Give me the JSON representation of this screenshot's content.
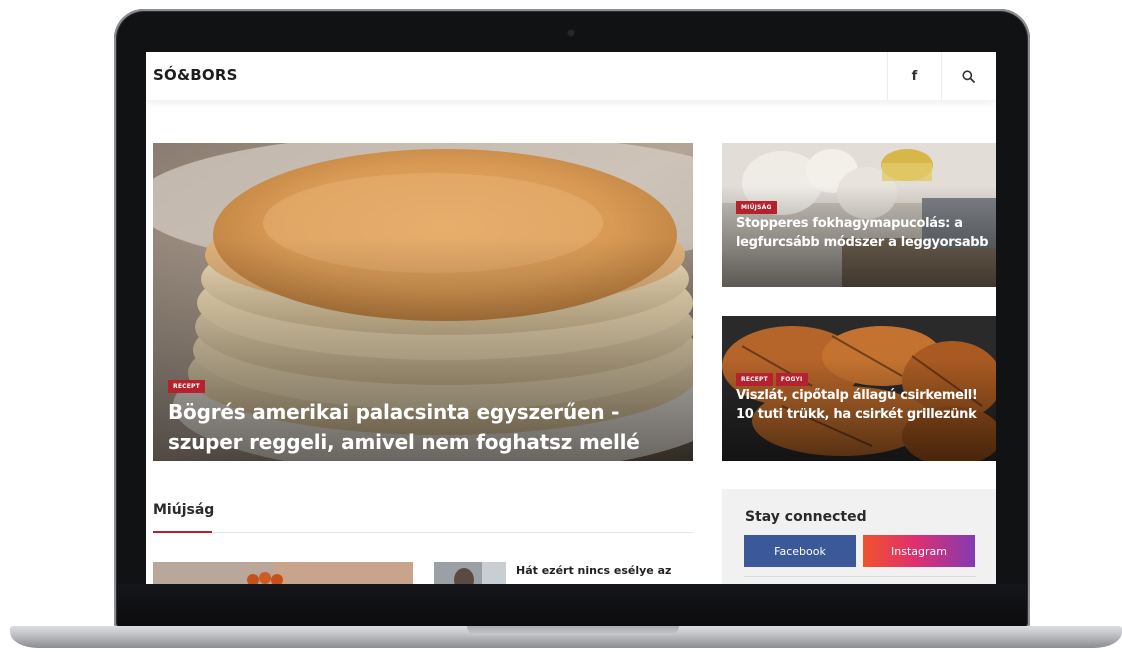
{
  "header": {
    "logo": "SÓ&BORS",
    "facebook_glyph": "f",
    "search_icon": "search-icon"
  },
  "hero": {
    "badge": "RECEPT",
    "title": "Bögrés amerikai palacsinta egyszerűen - szuper reggeli, amivel nem foghatsz mellé"
  },
  "side_cards": [
    {
      "badges": [
        "MIÚJSÁG"
      ],
      "title": "Stopperes fokhagymapucolás: a legfurcsább módszer a leggyorsabb"
    },
    {
      "badges": [
        "RECEPT",
        "FOGYI"
      ],
      "title": "Viszlát, cipőtalp állagú csirkemell! 10 tuti trükk, ha csirkét grillezünk"
    }
  ],
  "section": {
    "title": "Miújság",
    "news_item_title": "Hát ezért nincs esélye az"
  },
  "widget": {
    "title": "Stay connected",
    "facebook": "Facebook",
    "instagram": "Instagram"
  },
  "colors": {
    "accent": "#b5212c",
    "facebook": "#3b5998",
    "instagram_from": "#e1306c",
    "instagram_to": "#833ab4"
  }
}
